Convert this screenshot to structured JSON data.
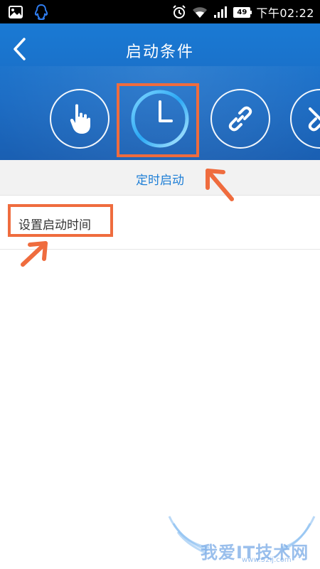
{
  "status_bar": {
    "time": "下午02:22",
    "battery": "49",
    "icons": [
      "gallery-icon",
      "qq-penguin-icon",
      "alarm-icon",
      "wifi-icon",
      "signal-icon"
    ]
  },
  "header": {
    "title": "启动条件",
    "back_icon": "chevron-left-icon",
    "conditions": [
      {
        "icon": "hand-tap-icon",
        "selected": false
      },
      {
        "icon": "clock-icon",
        "selected": true
      },
      {
        "icon": "link-icon",
        "selected": false
      },
      {
        "icon": "unlink-icon",
        "selected": false
      }
    ]
  },
  "subbar": {
    "label": "定时启动"
  },
  "rows": [
    {
      "label": "设置启动时间"
    }
  ],
  "watermark": {
    "text": "我爱IT技术网",
    "url": "www.52ij.com"
  },
  "colors": {
    "header_blue": "#1b6cc4",
    "accent_blue": "#1f7fd6",
    "annotation_orange": "#ef6c3e"
  }
}
